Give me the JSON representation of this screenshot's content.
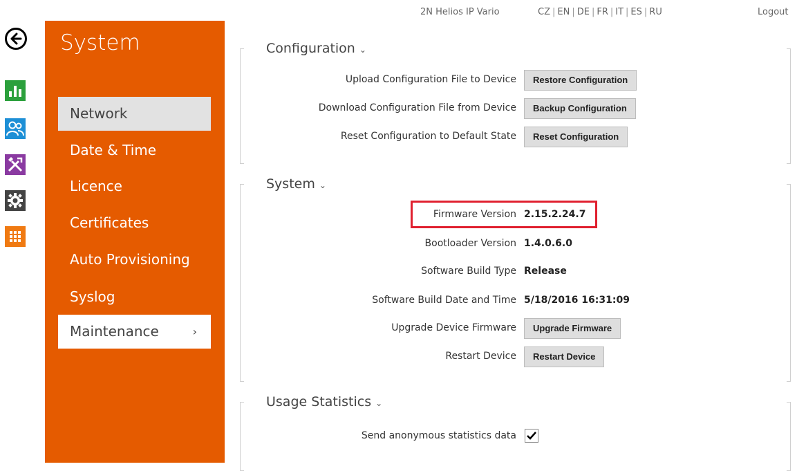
{
  "header": {
    "device_name": "2N Helios IP Vario",
    "languages": [
      "CZ",
      "EN",
      "DE",
      "FR",
      "IT",
      "ES",
      "RU"
    ],
    "logout_label": "Logout"
  },
  "sidebar": {
    "title": "System",
    "items": [
      {
        "label": "Network"
      },
      {
        "label": "Date & Time"
      },
      {
        "label": "Licence"
      },
      {
        "label": "Certificates"
      },
      {
        "label": "Auto Provisioning"
      },
      {
        "label": "Syslog"
      },
      {
        "label": "Maintenance"
      }
    ],
    "active_chevron": "›"
  },
  "rail_icons": [
    "back-arrow-icon",
    "statistics-icon",
    "users-icon",
    "services-icon",
    "system-gear-icon",
    "apps-grid-icon"
  ],
  "colors": {
    "sidebar_orange": "#e55b00",
    "highlight_red": "#e0202f",
    "stats_green": "#2ba03c",
    "users_blue": "#1d8fd6",
    "services_purple": "#8a3aa1",
    "system_dark": "#444444",
    "apps_orange": "#f07a12"
  },
  "configuration": {
    "title": "Configuration",
    "rows": [
      {
        "label": "Upload Configuration File to Device",
        "button": "Restore Configuration"
      },
      {
        "label": "Download Configuration File from Device",
        "button": "Backup Configuration"
      },
      {
        "label": "Reset Configuration to Default State",
        "button": "Reset Configuration"
      }
    ]
  },
  "system": {
    "title": "System",
    "firmware_label": "Firmware Version",
    "firmware_value": "2.15.2.24.7",
    "bootloader_label": "Bootloader Version",
    "bootloader_value": "1.4.0.6.0",
    "build_type_label": "Software Build Type",
    "build_type_value": "Release",
    "build_date_label": "Software Build Date and Time",
    "build_date_value": "5/18/2016 16:31:09",
    "upgrade_label": "Upgrade Device Firmware",
    "upgrade_button": "Upgrade Firmware",
    "restart_label": "Restart Device",
    "restart_button": "Restart Device"
  },
  "usage": {
    "title": "Usage Statistics",
    "send_label": "Send anonymous statistics data",
    "send_checked": true
  }
}
